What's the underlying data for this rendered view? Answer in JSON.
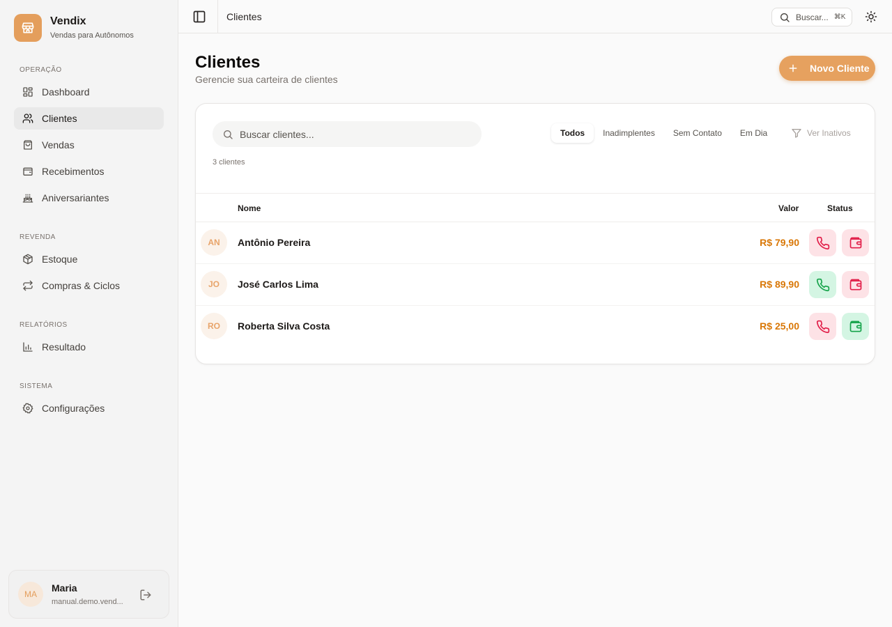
{
  "brand": {
    "name": "Vendix",
    "subtitle": "Vendas para Autônomos"
  },
  "sidebar": {
    "sections": [
      {
        "label": "OPERAÇÃO"
      },
      {
        "label": "REVENDA"
      },
      {
        "label": "RELATÓRIOS"
      },
      {
        "label": "SISTEMA"
      }
    ],
    "items": [
      {
        "label": "Dashboard",
        "icon": "dashboard-icon"
      },
      {
        "label": "Clientes",
        "icon": "users-icon",
        "active": true
      },
      {
        "label": "Vendas",
        "icon": "shopping-bag-icon"
      },
      {
        "label": "Recebimentos",
        "icon": "wallet-icon"
      },
      {
        "label": "Aniversariantes",
        "icon": "cake-icon"
      },
      {
        "label": "Estoque",
        "icon": "package-icon"
      },
      {
        "label": "Compras & Ciclos",
        "icon": "repeat-icon"
      },
      {
        "label": "Resultado",
        "icon": "bar-chart-icon"
      },
      {
        "label": "Configurações",
        "icon": "gear-icon"
      }
    ]
  },
  "user": {
    "initials": "MA",
    "name": "Maria",
    "email": "manual.demo.vend..."
  },
  "topbar": {
    "title": "Clientes",
    "search_label": "Buscar...",
    "shortcut": "⌘K"
  },
  "page": {
    "title": "Clientes",
    "subtitle": "Gerencie sua carteira de clientes",
    "new_button": "Novo Cliente"
  },
  "filters": {
    "search_placeholder": "Buscar clientes...",
    "tabs": [
      "Todos",
      "Inadimplentes",
      "Sem Contato",
      "Em Dia"
    ],
    "active_tab": "Todos",
    "inactive_toggle": "Ver Inativos"
  },
  "count_text": "3 clientes",
  "table": {
    "headers": {
      "name": "Nome",
      "value": "Valor",
      "status": "Status"
    },
    "rows": [
      {
        "initials": "AN",
        "name": "Antônio Pereira",
        "value": "R$ 79,90",
        "contact_status": "red",
        "payment_status": "red"
      },
      {
        "initials": "JO",
        "name": "José Carlos Lima",
        "value": "R$ 89,90",
        "contact_status": "green",
        "payment_status": "red"
      },
      {
        "initials": "RO",
        "name": "Roberta Silva Costa",
        "value": "R$ 25,00",
        "contact_status": "red",
        "payment_status": "green"
      }
    ]
  },
  "colors": {
    "accent": "#e6a15f",
    "value_text": "#d97706",
    "status_red": "#e11d48",
    "status_red_bg": "#fde2e6",
    "status_green": "#16a34a",
    "status_green_bg": "#d4f5e3"
  }
}
